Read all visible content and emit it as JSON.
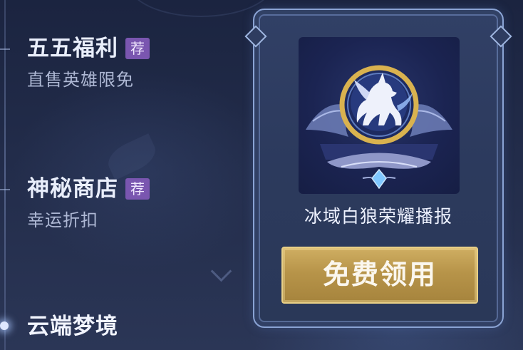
{
  "menu": {
    "items": [
      {
        "title": "五五福利",
        "badge": "荐",
        "subtitle": "直售英雄限免"
      },
      {
        "title": "神秘商店",
        "badge": "荐",
        "subtitle": "幸运折扣"
      },
      {
        "title": "云端梦境"
      }
    ]
  },
  "reward": {
    "name": "冰域白狼荣耀播报",
    "image_icon": "white-wolf-emblem-icon",
    "claim_label": "免费领用"
  },
  "colors": {
    "badge_purple": "#7a56b0",
    "button_gold": "#b79449",
    "card_border": "#8aa3d4"
  }
}
